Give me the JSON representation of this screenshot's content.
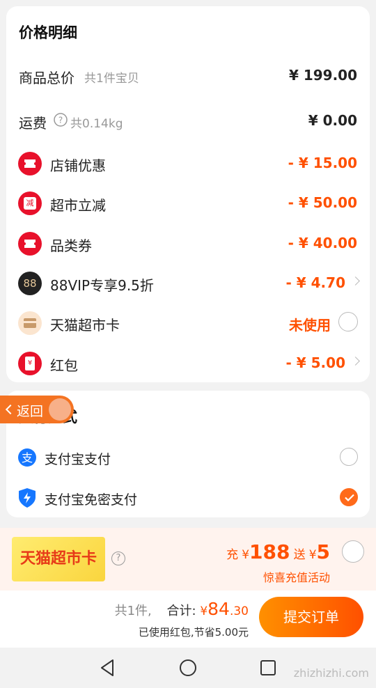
{
  "price_detail": {
    "title": "价格明细",
    "goods_total": {
      "label": "商品总价",
      "sub": "共1件宝贝",
      "amount": "¥ 199.00"
    },
    "shipping": {
      "label": "运费",
      "sub": "共0.14kg",
      "amount": "¥ 0.00"
    },
    "discounts": [
      {
        "label": "店铺优惠",
        "amount": "- ¥ 15.00",
        "icon": "ticket-icon"
      },
      {
        "label": "超市立减",
        "amount": "- ¥ 50.00",
        "icon": "reduce-badge-icon",
        "icon_text": "减"
      },
      {
        "label": "品类券",
        "amount": "- ¥ 40.00",
        "icon": "ticket-icon"
      },
      {
        "label": "88VIP专享9.5折",
        "amount": "- ¥ 4.70",
        "icon": "vip-88-icon",
        "icon_text": "88"
      },
      {
        "label": "天猫超市卡",
        "amount": "未使用",
        "icon": "wallet-card-icon"
      },
      {
        "label": "红包",
        "amount": "- ¥ 5.00",
        "icon": "red-packet-icon",
        "icon_text": "¥"
      }
    ]
  },
  "back_tab": {
    "label": "返回"
  },
  "payment": {
    "title": "支付方式",
    "methods": [
      {
        "label": "支付宝支付",
        "selected": false,
        "icon": "alipay-icon"
      },
      {
        "label": "支付宝免密支付",
        "selected": true,
        "icon": "shield-lightning-icon"
      }
    ]
  },
  "promo": {
    "badge": "天猫超市卡",
    "help": "?",
    "charge_prefix": "充",
    "charge_cur": "¥",
    "charge_amount": "188",
    "gift_prefix": "送",
    "gift_cur": "¥",
    "gift_amount": "5",
    "subtitle": "惊喜充值活动"
  },
  "checkout": {
    "count": "共1件,",
    "total_label": "合计:",
    "currency": "¥",
    "total_int": "84",
    "total_dec": ".30",
    "saved_text": "已使用红包,节省5.00元",
    "submit_label": "提交订单"
  },
  "watermark": "zhizhizhi.com",
  "colors": {
    "accent": "#ff5000",
    "badge_red": "#e8112b",
    "alipay_blue": "#1677ff"
  }
}
